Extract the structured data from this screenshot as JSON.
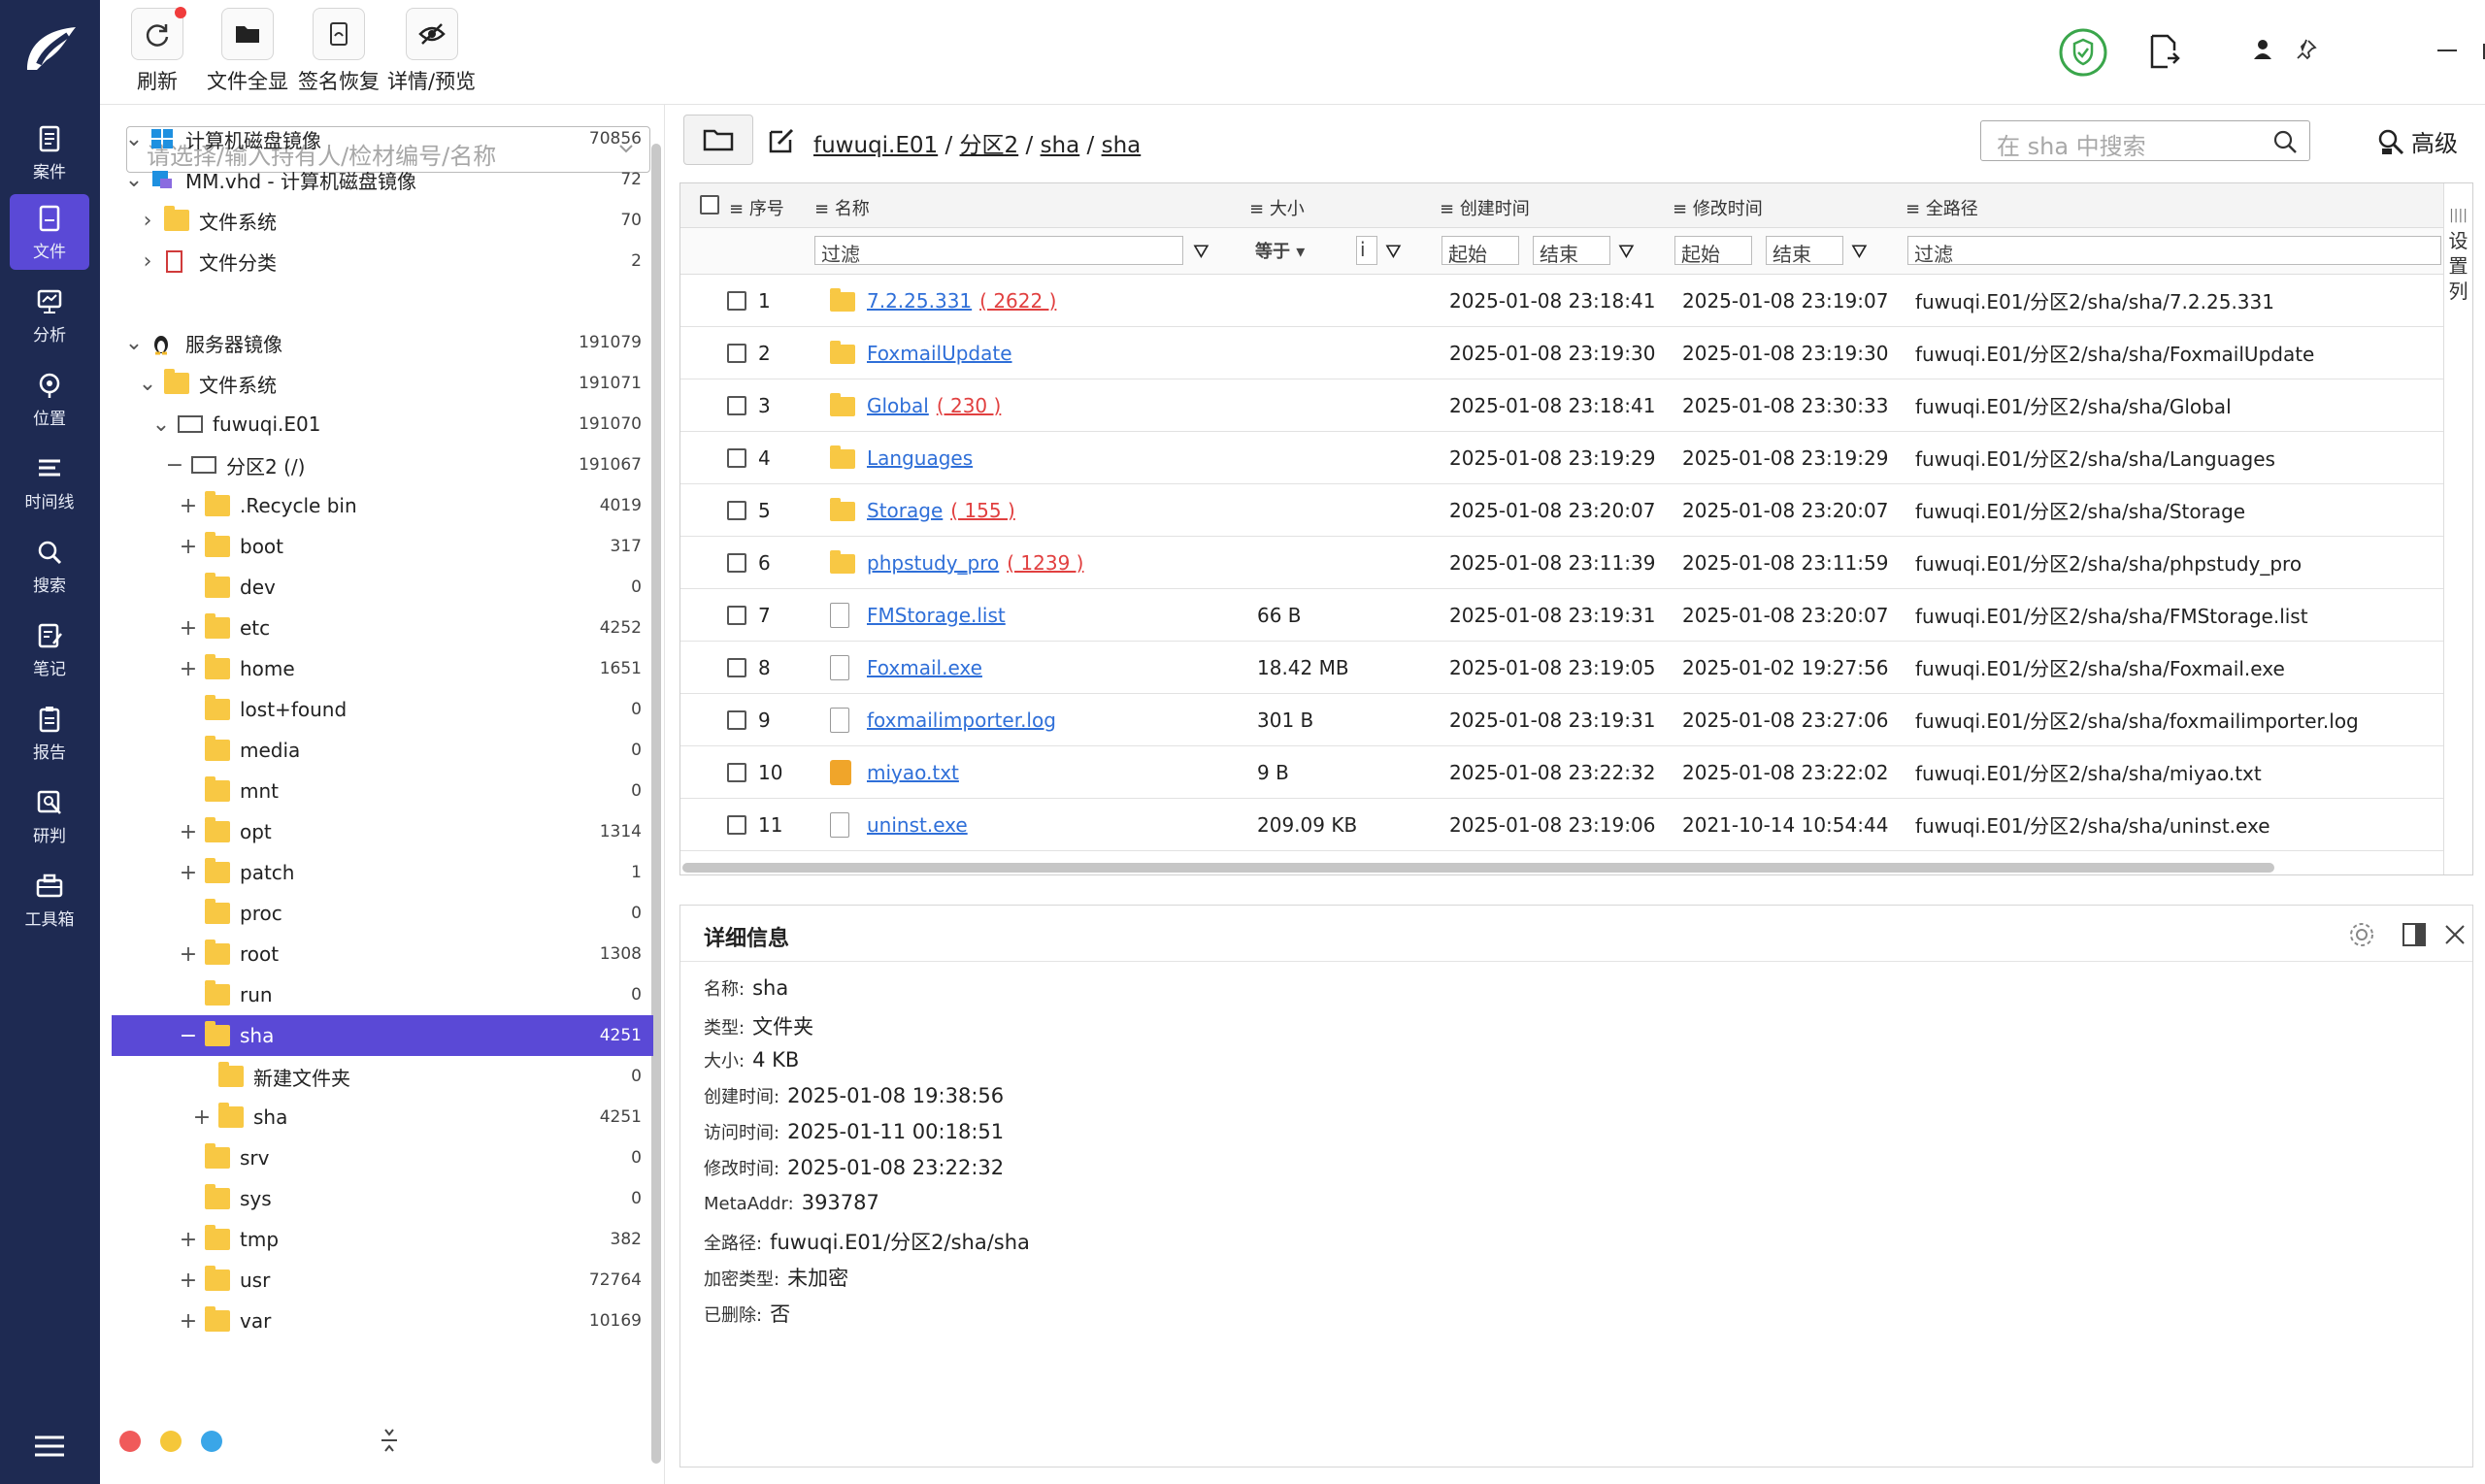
{
  "rail": {
    "items": [
      {
        "label": "案件",
        "icon": "case-icon"
      },
      {
        "label": "文件",
        "icon": "file-icon"
      },
      {
        "label": "分析",
        "icon": "analysis-icon"
      },
      {
        "label": "位置",
        "icon": "location-icon"
      },
      {
        "label": "时间线",
        "icon": "timeline-icon"
      },
      {
        "label": "搜索",
        "icon": "search-icon"
      },
      {
        "label": "笔记",
        "icon": "notes-icon"
      },
      {
        "label": "报告",
        "icon": "report-icon"
      },
      {
        "label": "研判",
        "icon": "research-icon"
      },
      {
        "label": "工具箱",
        "icon": "toolbox-icon"
      }
    ],
    "active_color": "#5a49d6",
    "bg_color": "#1e2a52"
  },
  "toolbar": {
    "refresh": "刷新",
    "show_all": "文件全显",
    "sig_restore": "签名恢复",
    "detail_preview": "详情/预览"
  },
  "tree": {
    "selector_placeholder": "请选择/输入持有人/检材编号/名称",
    "rows": [
      {
        "label": "计算机磁盘镜像",
        "count": "70856"
      },
      {
        "label": "MM.vhd - 计算机磁盘镜像",
        "count": "72"
      },
      {
        "label": "文件系统",
        "count": "70"
      },
      {
        "label": "文件分类",
        "count": "2"
      },
      {
        "label": "服务器镜像",
        "count": "191079"
      },
      {
        "label": "文件系统",
        "count": "191071"
      },
      {
        "label": "fuwuqi.E01",
        "count": "191070"
      },
      {
        "label": "分区2 (/)",
        "count": "191067"
      },
      {
        "label": ".Recycle bin",
        "count": "4019"
      },
      {
        "label": "boot",
        "count": "317"
      },
      {
        "label": "dev",
        "count": "0"
      },
      {
        "label": "etc",
        "count": "4252"
      },
      {
        "label": "home",
        "count": "1651"
      },
      {
        "label": "lost+found",
        "count": "0"
      },
      {
        "label": "media",
        "count": "0"
      },
      {
        "label": "mnt",
        "count": "0"
      },
      {
        "label": "opt",
        "count": "1314"
      },
      {
        "label": "patch",
        "count": "1"
      },
      {
        "label": "proc",
        "count": "0"
      },
      {
        "label": "root",
        "count": "1308"
      },
      {
        "label": "run",
        "count": "0"
      },
      {
        "label": "sha",
        "count": "4251"
      },
      {
        "label": "新建文件夹",
        "count": "0"
      },
      {
        "label": "sha",
        "count": "4251"
      },
      {
        "label": "srv",
        "count": "0"
      },
      {
        "label": "sys",
        "count": "0"
      },
      {
        "label": "tmp",
        "count": "382"
      },
      {
        "label": "usr",
        "count": "72764"
      },
      {
        "label": "var",
        "count": "10169"
      }
    ]
  },
  "path": {
    "crumbs": [
      "fuwuqi.E01",
      "分区2",
      "sha",
      "sha"
    ],
    "sep": "/",
    "search_placeholder": "在 sha 中搜索",
    "advanced": "高级"
  },
  "table": {
    "headers": {
      "index": "序号",
      "name": "名称",
      "size": "大小",
      "created": "创建时间",
      "modified": "修改时间",
      "fullpath": "全路径"
    },
    "filters": {
      "text": "过滤",
      "eq": "等于",
      "start": "起始",
      "end": "结束",
      "path": "过滤"
    },
    "side_label": [
      "设",
      "置",
      "列"
    ],
    "rows": [
      {
        "no": "1",
        "name": "7.2.25.331",
        "count": "( 2622 )",
        "size": "",
        "created": "2025-01-08 23:18:41",
        "modified": "2025-01-08 23:19:07",
        "path": "fuwuqi.E01/分区2/sha/sha/7.2.25.331",
        "kind": "folder"
      },
      {
        "no": "2",
        "name": "FoxmailUpdate",
        "count": "",
        "size": "",
        "created": "2025-01-08 23:19:30",
        "modified": "2025-01-08 23:19:30",
        "path": "fuwuqi.E01/分区2/sha/sha/FoxmailUpdate",
        "kind": "folder"
      },
      {
        "no": "3",
        "name": "Global",
        "count": "( 230 )",
        "size": "",
        "created": "2025-01-08 23:18:41",
        "modified": "2025-01-08 23:30:33",
        "path": "fuwuqi.E01/分区2/sha/sha/Global",
        "kind": "folder"
      },
      {
        "no": "4",
        "name": "Languages",
        "count": "",
        "size": "",
        "created": "2025-01-08 23:19:29",
        "modified": "2025-01-08 23:19:29",
        "path": "fuwuqi.E01/分区2/sha/sha/Languages",
        "kind": "folder"
      },
      {
        "no": "5",
        "name": "Storage",
        "count": "( 155 )",
        "size": "",
        "created": "2025-01-08 23:20:07",
        "modified": "2025-01-08 23:20:07",
        "path": "fuwuqi.E01/分区2/sha/sha/Storage",
        "kind": "folder"
      },
      {
        "no": "6",
        "name": "phpstudy_pro",
        "count": "( 1239 )",
        "size": "",
        "created": "2025-01-08 23:11:39",
        "modified": "2025-01-08 23:11:59",
        "path": "fuwuqi.E01/分区2/sha/sha/phpstudy_pro",
        "kind": "folder"
      },
      {
        "no": "7",
        "name": "FMStorage.list",
        "count": "",
        "size": "66 B",
        "created": "2025-01-08 23:19:31",
        "modified": "2025-01-08 23:20:07",
        "path": "fuwuqi.E01/分区2/sha/sha/FMStorage.list",
        "kind": "file"
      },
      {
        "no": "8",
        "name": "Foxmail.exe",
        "count": "",
        "size": "18.42 MB",
        "created": "2025-01-08 23:19:05",
        "modified": "2025-01-02 19:27:56",
        "path": "fuwuqi.E01/分区2/sha/sha/Foxmail.exe",
        "kind": "file"
      },
      {
        "no": "9",
        "name": "foxmailimporter.log",
        "count": "",
        "size": "301 B",
        "created": "2025-01-08 23:19:31",
        "modified": "2025-01-08 23:27:06",
        "path": "fuwuqi.E01/分区2/sha/sha/foxmailimporter.log",
        "kind": "file"
      },
      {
        "no": "10",
        "name": "miyao.txt",
        "count": "",
        "size": "9 B",
        "created": "2025-01-08 23:22:32",
        "modified": "2025-01-08 23:22:02",
        "path": "fuwuqi.E01/分区2/sha/sha/miyao.txt",
        "kind": "txt"
      },
      {
        "no": "11",
        "name": "uninst.exe",
        "count": "",
        "size": "209.09 KB",
        "created": "2025-01-08 23:19:06",
        "modified": "2021-10-14 10:54:44",
        "path": "fuwuqi.E01/分区2/sha/sha/uninst.exe",
        "kind": "file"
      }
    ]
  },
  "detail": {
    "title": "详细信息",
    "fields": [
      {
        "k": "名称:",
        "v": "sha"
      },
      {
        "k": "类型:",
        "v": "文件夹"
      },
      {
        "k": "大小:",
        "v": "4 KB"
      },
      {
        "k": "创建时间:",
        "v": "2025-01-08 19:38:56"
      },
      {
        "k": "访问时间:",
        "v": "2025-01-11 00:18:51"
      },
      {
        "k": "修改时间:",
        "v": "2025-01-08 23:22:32"
      },
      {
        "k": "MetaAddr:",
        "v": "393787"
      },
      {
        "k": "全路径:",
        "v": "fuwuqi.E01/分区2/sha/sha"
      },
      {
        "k": "加密类型:",
        "v": "未加密"
      },
      {
        "k": "已删除:",
        "v": "否"
      }
    ]
  },
  "colors": {
    "accent": "#5a49d6",
    "link": "#2f6fd8",
    "count": "#e14040",
    "folder": "#f8c844"
  }
}
